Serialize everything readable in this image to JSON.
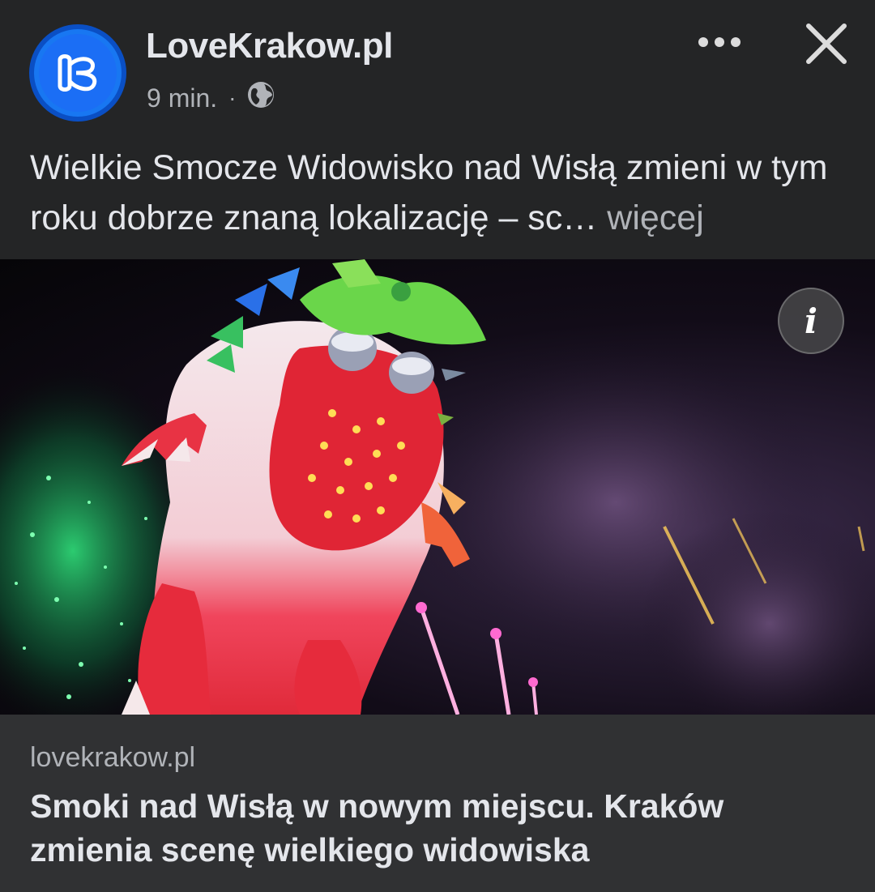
{
  "post": {
    "page_name": "LoveKrakow.pl",
    "time": "9 min.",
    "separator": "·",
    "audience_icon": "globe-icon",
    "text": "Wielkie Smocze Widowisko nad Wisłą zmieni w tym roku dobrze znaną lokalizację – sc…",
    "see_more": "więcej"
  },
  "toolbar": {
    "more_icon": "more-dots-icon",
    "close_icon": "close-icon"
  },
  "image": {
    "info_label": "i"
  },
  "link_preview": {
    "domain": "lovekrakow.pl",
    "title": "Smoki nad Wisłą w nowym miejscu. Kraków zmienia scenę wielkiego widowiska"
  },
  "colors": {
    "background": "#242526",
    "card": "#303133",
    "text": "#e4e6eb",
    "muted": "#b0b3b8",
    "brand": "#1877f2"
  }
}
